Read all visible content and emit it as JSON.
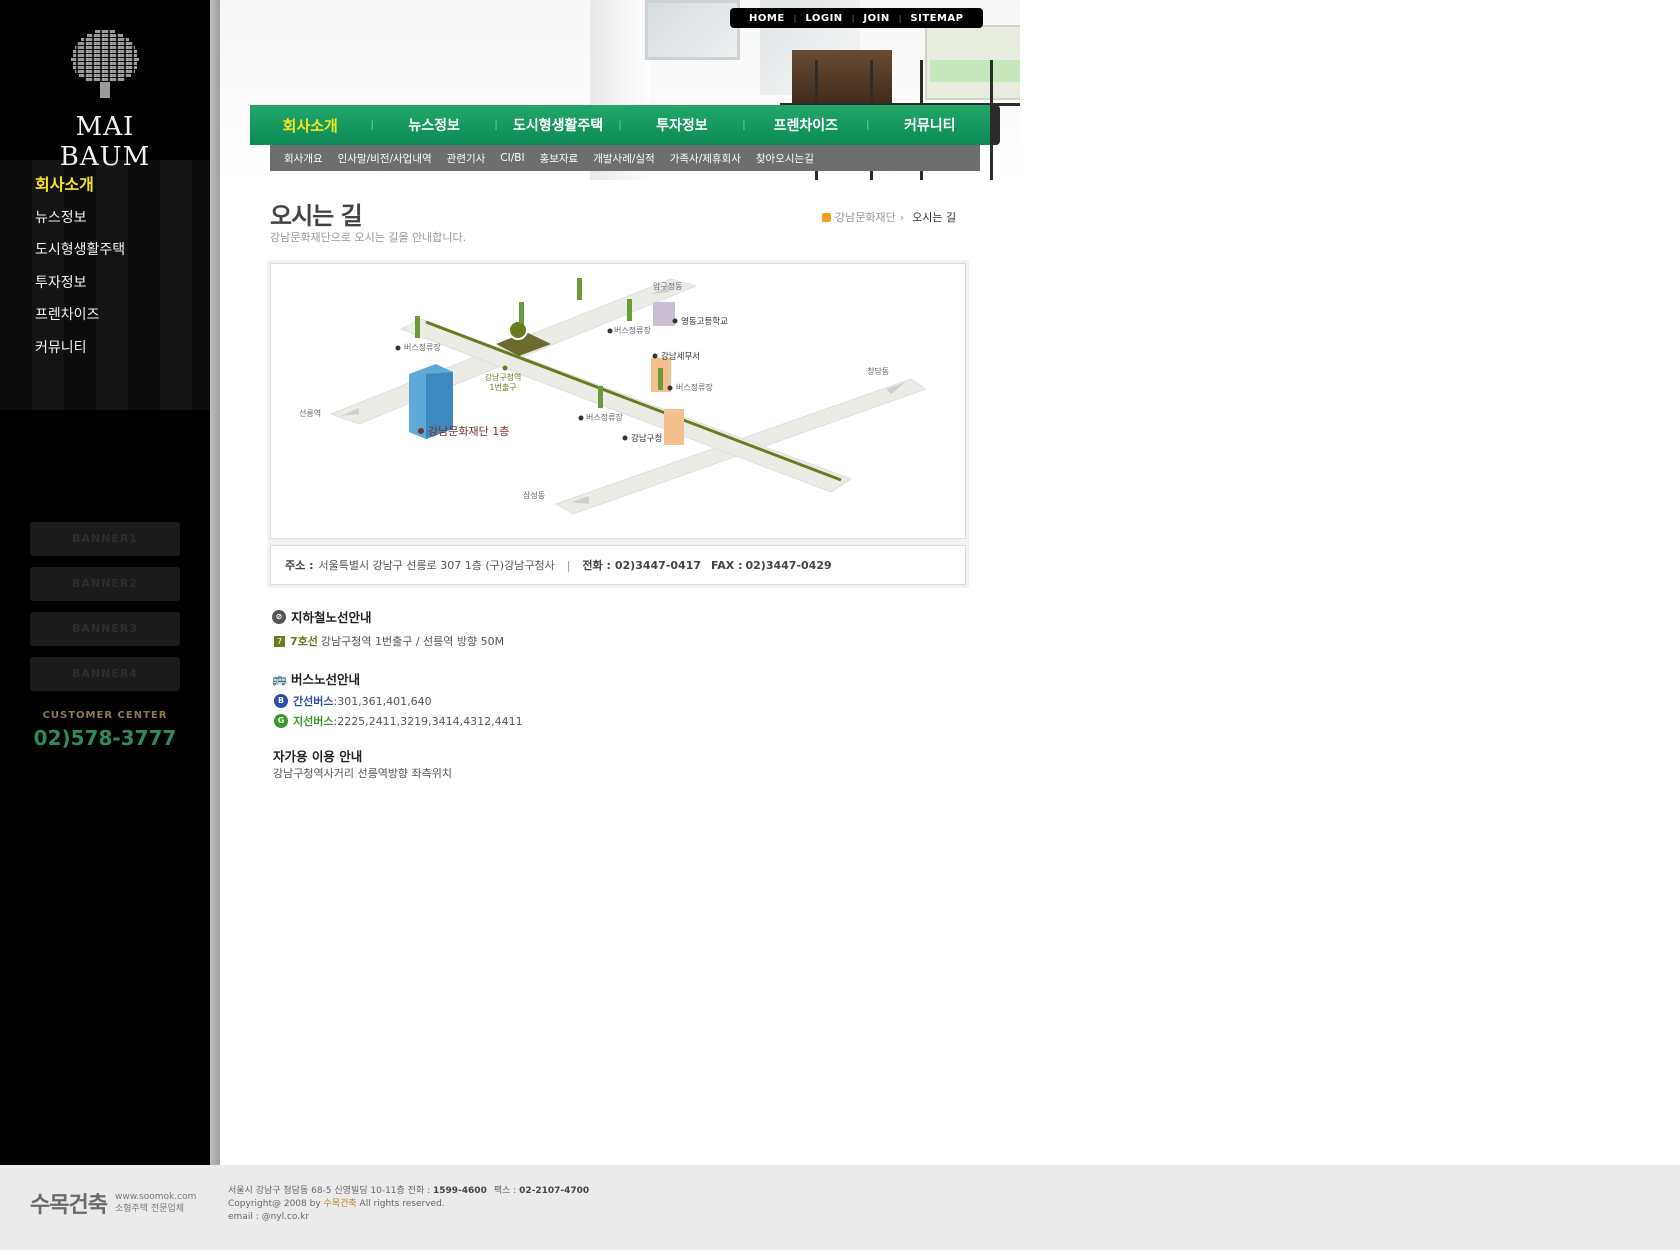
{
  "brand": {
    "name": "MAI BAUM",
    "logo_icon": "tree-dots-icon"
  },
  "side_menu": [
    {
      "label": "회사소개",
      "active": true
    },
    {
      "label": "뉴스정보"
    },
    {
      "label": "도시형생활주택"
    },
    {
      "label": "투자정보"
    },
    {
      "label": "프렌차이즈"
    },
    {
      "label": "커뮤니티"
    }
  ],
  "banners": [
    "BANNER1",
    "BANNER2",
    "BANNER3",
    "BANNER4"
  ],
  "customer_center": {
    "label": "CUSTOMER CENTER",
    "phone": "02)578-3777"
  },
  "top_links": [
    "HOME",
    "LOGIN",
    "JOIN",
    "SITEMAP"
  ],
  "gnb": [
    "회사소개",
    "뉴스정보",
    "도시형생활주택",
    "투자정보",
    "프렌차이즈",
    "커뮤니티"
  ],
  "sub_gnb": [
    "회사개요",
    "인사말/비전/사업내역",
    "관련기사",
    "CI/BI",
    "홍보자료",
    "개발사례/실적",
    "가족사/제휴회사",
    "찾아오시는길"
  ],
  "page": {
    "title": "오시는 길",
    "subtitle": "강남문화재단으로 오시는 길을 안내합니다.",
    "breadcrumb": {
      "parent": "강남문화재단",
      "current": "오시는 길"
    }
  },
  "map": {
    "labels": {
      "apgujeong": "압구정동",
      "cheongdam": "청담동",
      "seolleung": "선릉역",
      "samseong": "삼성동",
      "yeongdong_hs": "영동고등학교",
      "tax_office": "강남세무서",
      "district_office": "강남구청",
      "station_exit_1": "강남구청역",
      "station_exit_2": "1번출구",
      "foundation": "강남문화재단 1층",
      "bus_stop": "버스정류장"
    }
  },
  "address": {
    "label": "주소 :",
    "value": "서울특별시 강남구 선릉로 307 1층 (구)강남구청사",
    "sep": "|",
    "tel_label": "전화 :",
    "tel": "02)3447-0417",
    "fax_label": "FAX :",
    "fax": "02)3447-0429"
  },
  "subway": {
    "title": "지하철노선안내",
    "line_badge": "7",
    "line": "7호선",
    "desc": "강남구청역 1번출구 / 선릉역 방향 50M"
  },
  "bus": {
    "title": "버스노선안내",
    "trunk_badge": "B",
    "trunk_label": "간선버스",
    "trunk_routes": ":301,361,401,640",
    "branch_badge": "G",
    "branch_label": "지선버스",
    "branch_routes": ":2225,2411,3219,3414,4312,4411"
  },
  "car": {
    "title": "자가용 이용 안내",
    "desc": "강남구청역사거리 선릉역방향 좌측위치"
  },
  "footer": {
    "logo": "수목건축",
    "site": "www.soomok.com",
    "tagline": "소형주택 전문업체",
    "line1_prefix": "서울시 강남구 청담동 68-5 신영빌딩 10-11층  전화 :",
    "tel": "1599-4600",
    "line1_fax_label": "팩스 :",
    "fax": "02-2107-4700",
    "copy_prefix": "Copyright@ 2008 by",
    "copy_brand": "수목건축",
    "copy_suffix": "All rights reserved.",
    "email": "email : @nyl.co.kr"
  },
  "colors": {
    "accent_green": "#0b8a56",
    "active_yellow": "#f5e51b",
    "subway_line7": "#6b7a1f",
    "bus_trunk": "#2b4fa8",
    "bus_branch": "#3a9a2a"
  }
}
